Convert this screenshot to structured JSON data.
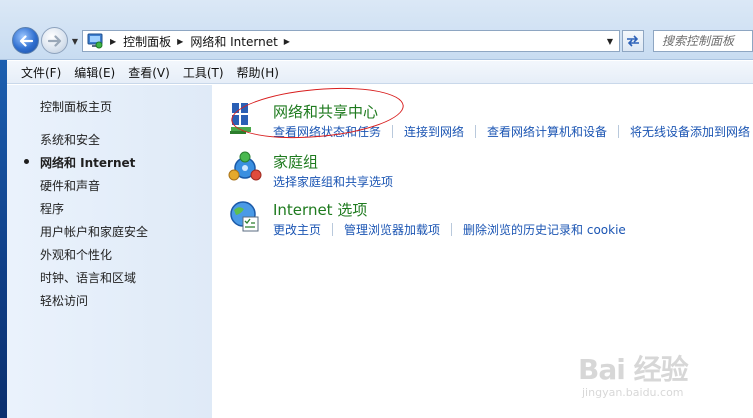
{
  "address_bar": {
    "breadcrumbs": [
      "控制面板",
      "网络和 Internet"
    ],
    "search_placeholder": "搜索控制面板"
  },
  "menu": {
    "items": [
      "文件(F)",
      "编辑(E)",
      "查看(V)",
      "工具(T)",
      "帮助(H)"
    ]
  },
  "left_nav": {
    "home": "控制面板主页",
    "items": [
      {
        "label": "系统和安全",
        "current": false
      },
      {
        "label": "网络和 Internet",
        "current": true
      },
      {
        "label": "硬件和声音",
        "current": false
      },
      {
        "label": "程序",
        "current": false
      },
      {
        "label": "用户帐户和家庭安全",
        "current": false
      },
      {
        "label": "外观和个性化",
        "current": false
      },
      {
        "label": "时钟、语言和区域",
        "current": false
      },
      {
        "label": "轻松访问",
        "current": false
      }
    ]
  },
  "categories": [
    {
      "title": "网络和共享中心",
      "icon": "network-sharing-icon",
      "links": [
        "查看网络状态和任务",
        "连接到网络",
        "查看网络计算机和设备",
        "将无线设备添加到网络"
      ]
    },
    {
      "title": "家庭组",
      "icon": "homegroup-icon",
      "links": [
        "选择家庭组和共享选项"
      ]
    },
    {
      "title": "Internet 选项",
      "icon": "internet-options-icon",
      "links": [
        "更改主页",
        "管理浏览器加载项",
        "删除浏览的历史记录和 cookie"
      ]
    }
  ],
  "watermark": {
    "brand": "Bai 经验",
    "url": "jingyan.baidu.com"
  },
  "colors": {
    "category_title": "#1e7a1e",
    "link": "#1b55b3",
    "annotation": "#d81e1e"
  }
}
